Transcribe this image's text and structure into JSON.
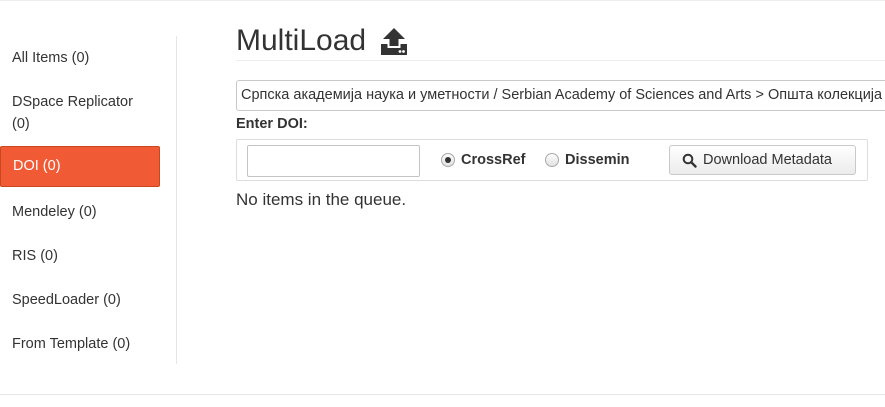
{
  "sidebar": {
    "items": [
      {
        "label": "All Items (0)"
      },
      {
        "label": "DSpace Replicator (0)"
      },
      {
        "label": "DOI (0)",
        "active": true
      },
      {
        "label": "Mendeley (0)"
      },
      {
        "label": "RIS (0)"
      },
      {
        "label": "SpeedLoader (0)"
      },
      {
        "label": "From Template (0)"
      }
    ]
  },
  "header": {
    "title": "MultiLoad",
    "icon": "upload-icon"
  },
  "collection": {
    "selected": "Српска академија наука и уметности / Serbian Academy of Sciences and Arts > Општа колекција / General Collection"
  },
  "doi_form": {
    "label": "Enter DOI:",
    "input_value": "",
    "sources": [
      {
        "label": "CrossRef",
        "checked": true
      },
      {
        "label": "Dissemin",
        "checked": false
      }
    ],
    "button_label": "Download Metadata",
    "button_icon": "search-icon"
  },
  "queue": {
    "message": "No items in the queue."
  },
  "colors": {
    "accent": "#f05a35",
    "text": "#333333"
  }
}
